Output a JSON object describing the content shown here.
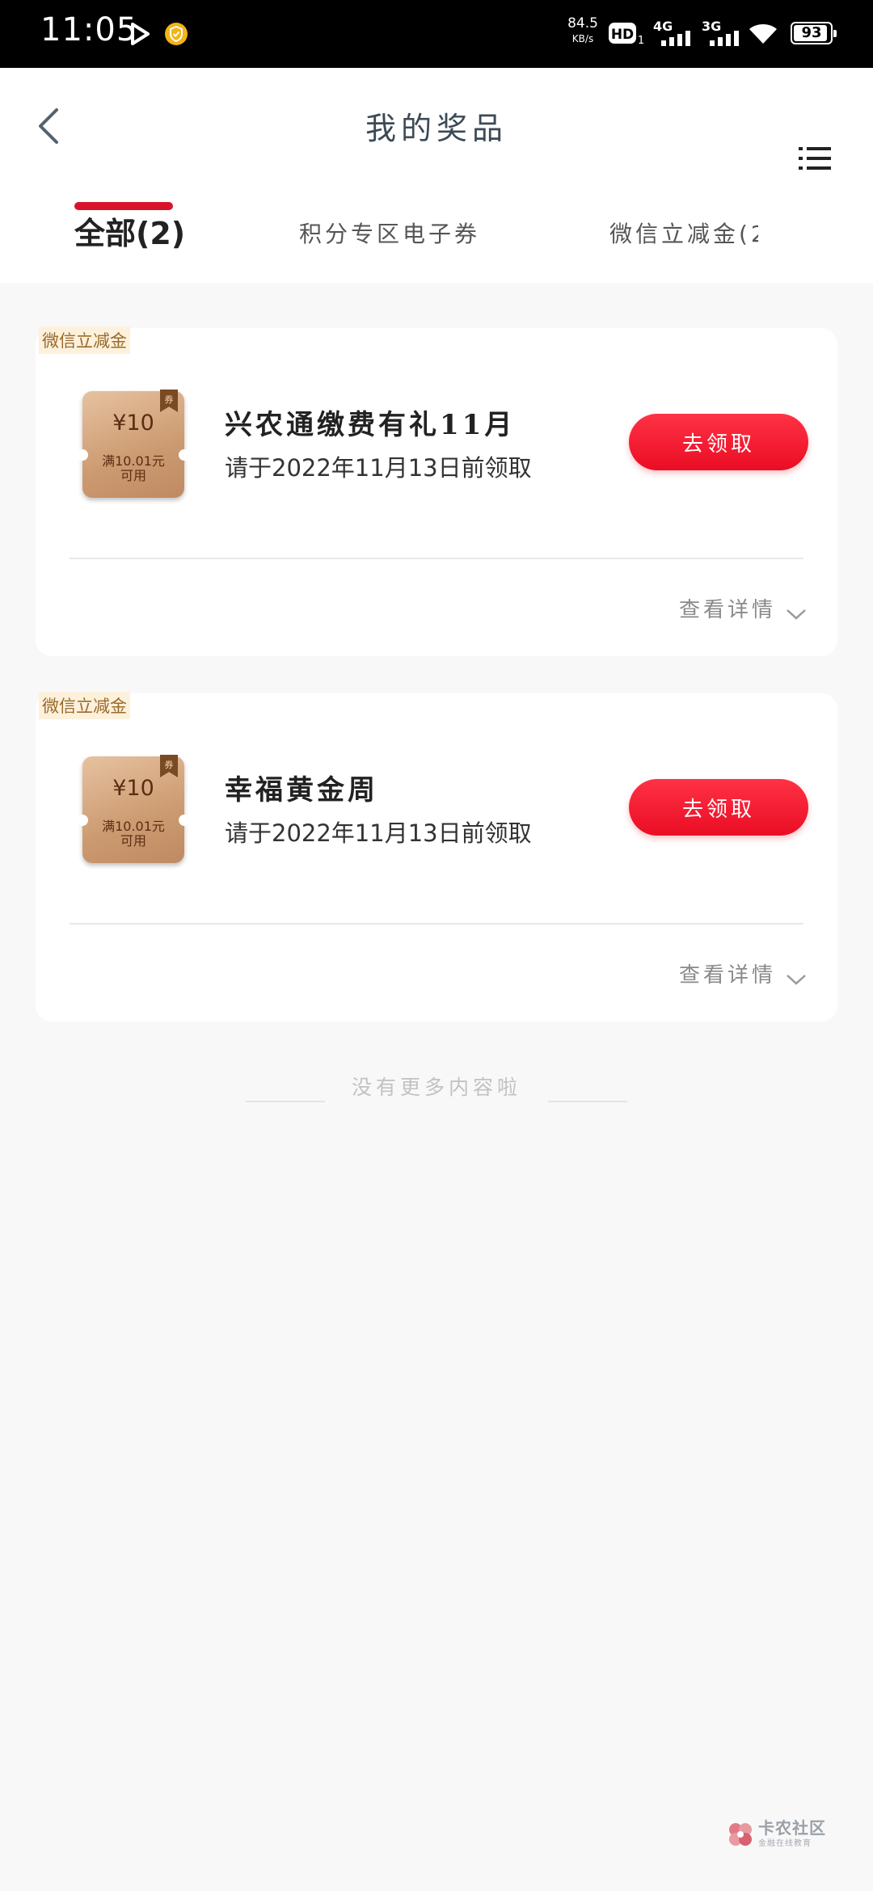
{
  "status_bar": {
    "time": "11:05",
    "net_speed": "84.5",
    "net_speed_unit": "KB/s",
    "hd_label": "HD",
    "hd_sub": "1",
    "net1_label": "4G",
    "net2_label": "3G",
    "battery_level": "93",
    "battery_fraction": 0.93
  },
  "header": {
    "title": "我的奖品",
    "back_icon": "chevron-left-icon",
    "menu_icon": "list-icon"
  },
  "tabs": [
    {
      "label": "全部(2)",
      "active": true
    },
    {
      "label": "积分专区电子券",
      "active": false
    },
    {
      "label": "微信立减金(2",
      "active": false
    }
  ],
  "colors": {
    "accent": "#d8142b",
    "button": "#ef1328",
    "tag_text": "#9a6a2c",
    "coupon": "#cc9a70"
  },
  "prizes": [
    {
      "tag": "微信立减金",
      "coupon_amount": "¥10",
      "coupon_ribbon": "券",
      "coupon_condition_1": "满10.01元",
      "coupon_condition_2": "可用",
      "title": "兴农通缴费有礼11月",
      "deadline": "请于2022年11月13日前领取",
      "claim_label": "去领取",
      "details_label": "查看详情"
    },
    {
      "tag": "微信立减金",
      "coupon_amount": "¥10",
      "coupon_ribbon": "券",
      "coupon_condition_1": "满10.01元",
      "coupon_condition_2": "可用",
      "title": "幸福黄金周",
      "deadline": "请于2022年11月13日前领取",
      "claim_label": "去领取",
      "details_label": "查看详情"
    }
  ],
  "footer": {
    "no_more": "没有更多内容啦"
  },
  "watermark": {
    "name": "卡农社区",
    "sub": "金融在线教育"
  }
}
